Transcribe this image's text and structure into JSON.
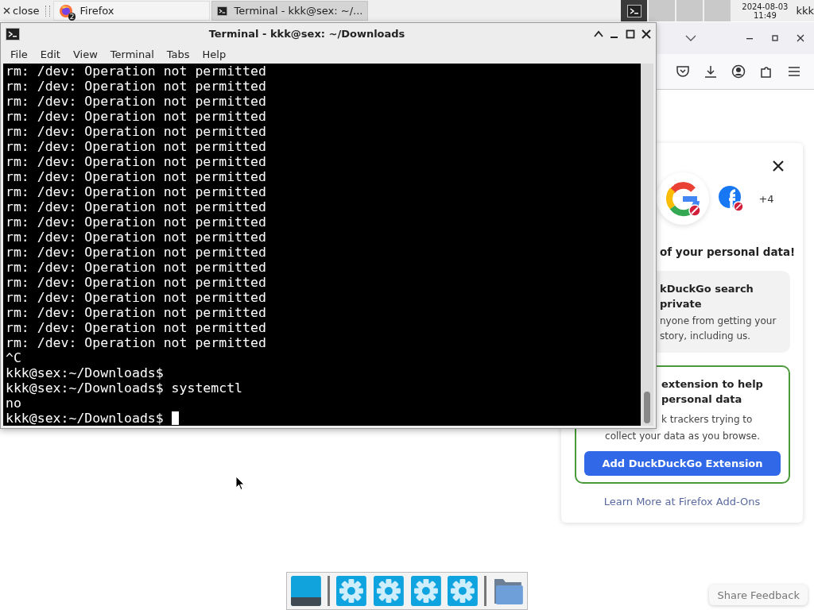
{
  "top_panel": {
    "close_label": "close",
    "tasks": [
      {
        "label": "Firefox",
        "badge": "2",
        "selected": false
      },
      {
        "label": "Terminal - kkk@sex: ~/...",
        "selected": true
      }
    ],
    "clock": {
      "date": "2024-08-03",
      "time": "11:49"
    },
    "user": "kkk"
  },
  "browser": {
    "popup": {
      "more_count": "+4",
      "heading": "of your personal data!",
      "cards": [
        {
          "kind": "info",
          "title_lines": [
            "kDuckGo search",
            "private"
          ],
          "body_lines": [
            "nyone from getting your",
            "story, including us."
          ]
        },
        {
          "kind": "extension",
          "title_lines": [
            "extension to help",
            "personal data"
          ],
          "body_lines": [
            "k trackers trying to",
            "collect your data as you browse."
          ],
          "button": "Add DuckDuckGo Extension"
        }
      ],
      "link": "Learn More at Firefox Add-Ons"
    },
    "feedback_button": "Share Feedback"
  },
  "terminal": {
    "title": "Terminal - kkk@sex: ~/Downloads",
    "menu": [
      "File",
      "Edit",
      "View",
      "Terminal",
      "Tabs",
      "Help"
    ],
    "lines": [
      "rm: /dev: Operation not permitted",
      "rm: /dev: Operation not permitted",
      "rm: /dev: Operation not permitted",
      "rm: /dev: Operation not permitted",
      "rm: /dev: Operation not permitted",
      "rm: /dev: Operation not permitted",
      "rm: /dev: Operation not permitted",
      "rm: /dev: Operation not permitted",
      "rm: /dev: Operation not permitted",
      "rm: /dev: Operation not permitted",
      "rm: /dev: Operation not permitted",
      "rm: /dev: Operation not permitted",
      "rm: /dev: Operation not permitted",
      "rm: /dev: Operation not permitted",
      "rm: /dev: Operation not permitted",
      "rm: /dev: Operation not permitted",
      "rm: /dev: Operation not permitted",
      "rm: /dev: Operation not permitted",
      "rm: /dev: Operation not permitted",
      "^C",
      "kkk@sex:~/Downloads$",
      "kkk@sex:~/Downloads$ systemctl",
      "no",
      "kkk@sex:~/Downloads$"
    ]
  },
  "dock": {
    "items": [
      {
        "kind": "desktop"
      },
      {
        "kind": "settings"
      },
      {
        "kind": "settings"
      },
      {
        "kind": "settings"
      },
      {
        "kind": "settings"
      },
      {
        "kind": "folder"
      }
    ]
  }
}
